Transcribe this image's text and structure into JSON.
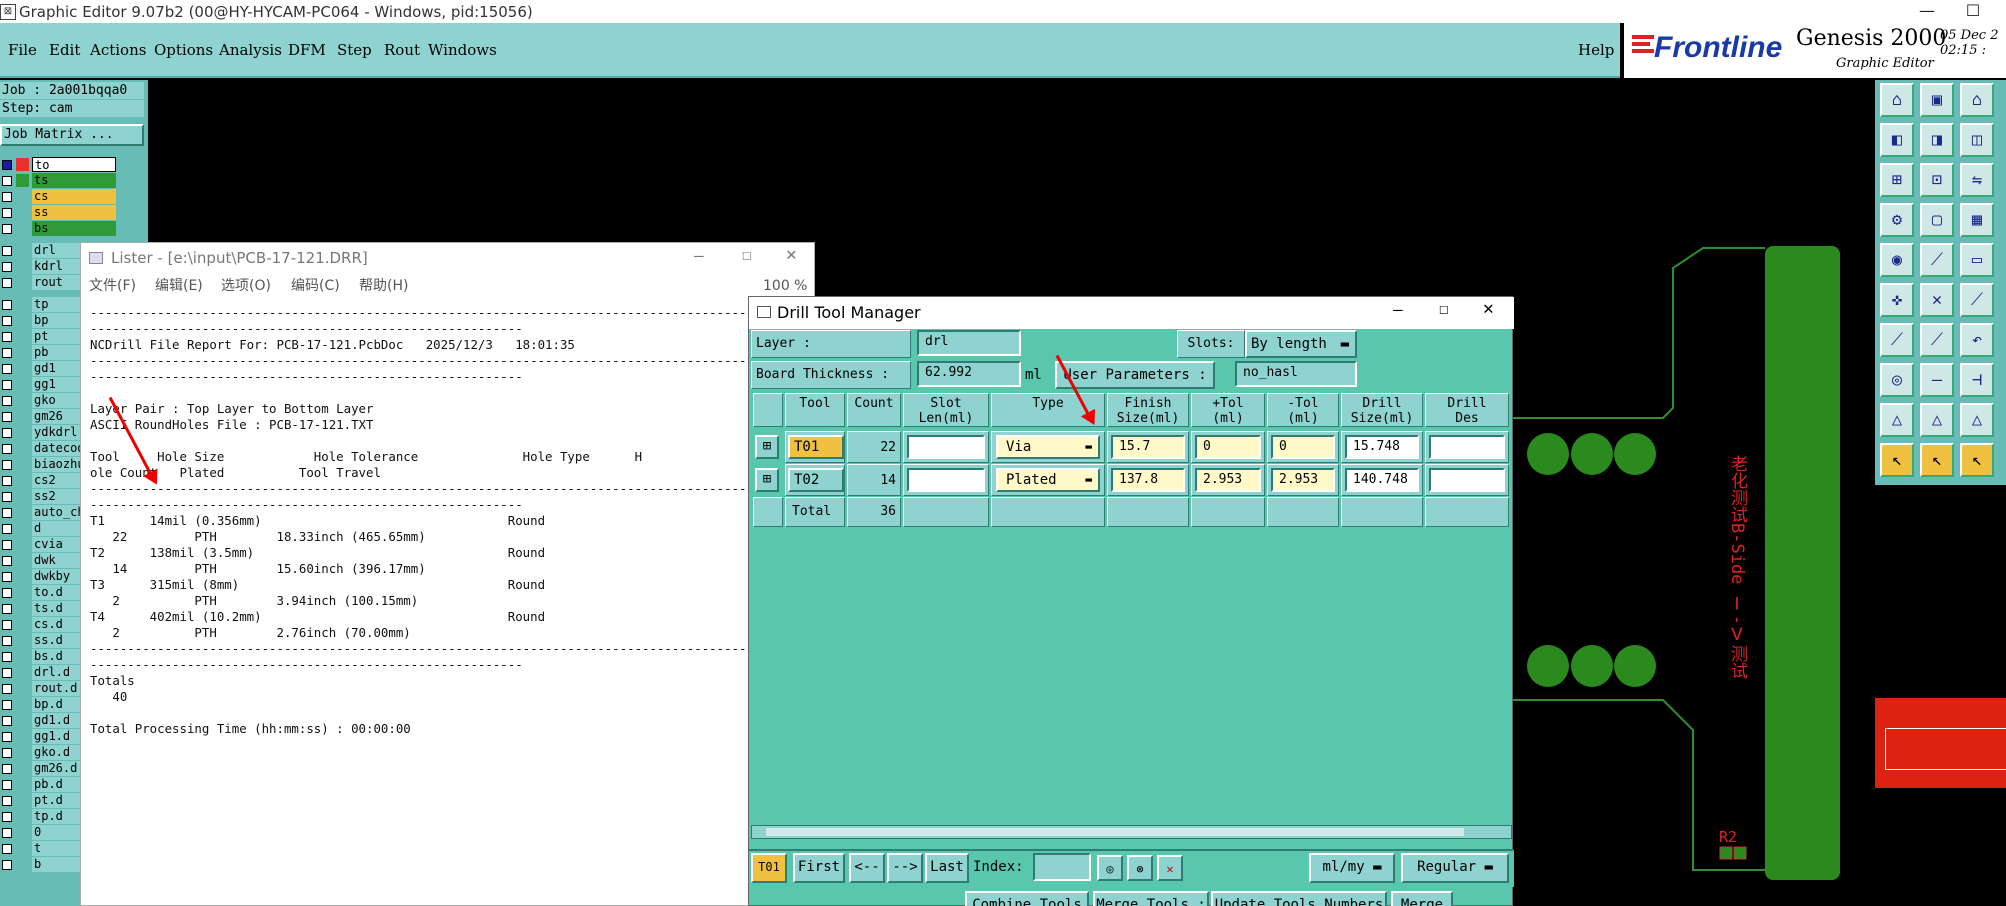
{
  "title_bar": {
    "text": "Graphic Editor 9.07b2 (00@HY-HYCAM-PC064 - Windows, pid:15056)",
    "minimize": "—",
    "maximize": "☐"
  },
  "menubar": {
    "items": [
      "File",
      "Edit",
      "Actions",
      "Options",
      "Analysis",
      "DFM",
      "Step",
      "Rout",
      "Windows"
    ],
    "help": "Help"
  },
  "brand": {
    "logo": "Frontline",
    "product": "Genesis 2000",
    "subtitle": "Graphic Editor",
    "date": "05 Dec 2",
    "time": "02:15 :"
  },
  "left_panel": {
    "job": "Job : 2a001bqqa0",
    "step": "Step: cam",
    "job_matrix": "Job Matrix ...",
    "layers": [
      "to",
      "ts",
      "cs",
      "ss",
      "bs",
      "",
      "drl",
      "kdrl",
      "rout",
      "",
      "tp",
      "bp",
      "pt",
      "pb",
      "gd1",
      "gg1",
      "gko",
      "gm26",
      "ydkdrl",
      "datecod",
      "biaozhu",
      "cs2",
      "ss2",
      "auto_ch",
      "d",
      "cvia",
      "dwk",
      "dwkby",
      "to.d",
      "ts.d",
      "cs.d",
      "ss.d",
      "bs.d",
      "drl.d",
      "rout.d",
      "bp.d",
      "gd1.d",
      "gg1.d",
      "gko.d",
      "gm26.d",
      "pb.d",
      "pt.d",
      "tp.d",
      "0",
      "t",
      "b"
    ],
    "colors": {
      "to": "#ffffff",
      "ts": "#2e9a3a",
      "cs": "#f0c040",
      "ss": "#f0c040",
      "bs": "#2e9a3a",
      "red": "#e83030"
    }
  },
  "lister": {
    "title": "Lister - [e:\\input\\PCB-17-121.DRR]",
    "zoom": "100 %",
    "menu": [
      "文件(F)",
      "编辑(E)",
      "选项(O)",
      "编码(C)",
      "帮助(H)"
    ],
    "report": "-----------------------------------------------------------------------------------------------------------------------\n----------------------------------------------------------\nNCDrill File Report For: PCB-17-121.PcbDoc   2025/12/3   18:01:35\n-----------------------------------------------------------------------------------------------------------------------\n----------------------------------------------------------\n\nLayer Pair : Top Layer to Bottom Layer\nASCII RoundHoles File : PCB-17-121.TXT\n\nTool     Hole Size            Hole Tolerance              Hole Type      H\nole Count   Plated          Tool Travel\n-----------------------------------------------------------------------------------------------------------------------\n----------------------------------------------------------\nT1      14mil (0.356mm)                                 Round\n   22         PTH        18.33inch (465.65mm)\nT2      138mil (3.5mm)                                  Round\n   14         PTH        15.60inch (396.17mm)\nT3      315mil (8mm)                                    Round\n   2          PTH        3.94inch (100.15mm)\nT4      402mil (10.2mm)                                 Round\n   2          PTH        2.76inch (70.00mm)\n-----------------------------------------------------------------------------------------------------------------------\n----------------------------------------------------------\nTotals\n   40\n\nTotal Processing Time (hh:mm:ss) : 00:00:00"
  },
  "drill_tool_manager": {
    "title": "Drill Tool Manager",
    "layer_label": "Layer          :",
    "layer_value": "drl",
    "slots_label": "Slots:",
    "slots_value": "By length",
    "thickness_label": "Board Thickness :",
    "thickness_value": "62.992",
    "thickness_unit": "ml",
    "user_params_label": "User Parameters :",
    "user_params_value": "no_hasl",
    "columns": [
      "Tool",
      "Count",
      "Slot\nLen(ml)",
      "Type",
      "Finish\nSize(ml)",
      "+Tol\n(ml)",
      "-Tol\n(ml)",
      "Drill\nSize(ml)",
      "Drill\nDes"
    ],
    "rows": [
      {
        "tool": "T01",
        "count": "22",
        "slot": "",
        "type": "Via",
        "finish": "15.7",
        "ptol": "0",
        "mtol": "0",
        "drill": "15.748",
        "des": ""
      },
      {
        "tool": "T02",
        "count": "14",
        "slot": "",
        "type": "Plated",
        "finish": "137.8",
        "ptol": "2.953",
        "mtol": "2.953",
        "drill": "140.748",
        "des": ""
      }
    ],
    "total_label": "Total",
    "total_count": "36",
    "footer": {
      "current": "T01",
      "first": "First",
      "prev": "<--",
      "next": "-->",
      "last": "Last",
      "index_label": "Index:",
      "units": "ml/my",
      "mode": "Regular"
    },
    "bottom_buttons": [
      "Combine Tools",
      "Merge Tools :",
      "Update Tools Numbers",
      "Merge"
    ]
  },
  "canvas": {
    "text_vertical": "老化测试B-Side  Ⅰ-Ⅴ测试",
    "label_r2": "R2"
  }
}
